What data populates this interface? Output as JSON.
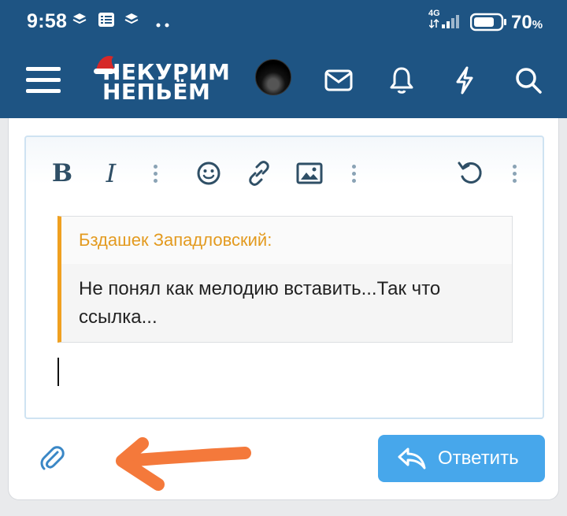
{
  "status_bar": {
    "time": "9:58",
    "network": "4G",
    "battery_percent": "70",
    "battery_unit": "%",
    "icons": [
      "layers-icon",
      "list-icon",
      "layers-icon",
      "more-dots-icon",
      "signal-icon",
      "battery-icon"
    ]
  },
  "header": {
    "logo_line1": "НЕКУРИМ",
    "logo_line2": "НЕПЬЁМ",
    "icons": [
      "hamburger-menu-icon",
      "user-avatar",
      "mail-icon",
      "bell-icon",
      "lightning-icon",
      "search-icon"
    ]
  },
  "toolbar": {
    "bold_label": "B",
    "italic_label": "I",
    "icons": [
      "bold-icon",
      "italic-icon",
      "more-vertical-icon",
      "emoji-icon",
      "link-icon",
      "image-icon",
      "more-vertical-icon",
      "undo-icon",
      "more-vertical-icon"
    ]
  },
  "quote": {
    "author": "Бздашек Западловский:",
    "text": "Не понял как мелодию вставить...Так что ссылка..."
  },
  "footer": {
    "reply_label": "Ответить",
    "icons": [
      "paperclip-icon",
      "reply-icon"
    ]
  },
  "colors": {
    "header_bg": "#1e5483",
    "reply_button": "#47a7eb",
    "quote_accent": "#f0a020",
    "annotation_arrow": "#f4793b"
  }
}
